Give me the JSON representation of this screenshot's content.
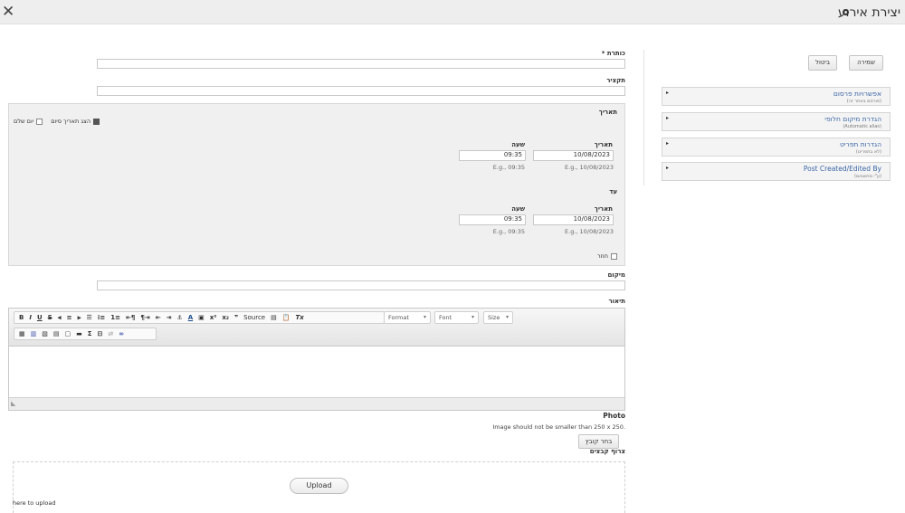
{
  "window": {
    "title": "יצירת אירוע"
  },
  "form": {
    "title_label": "כותרת *",
    "title_value": "",
    "summary_label": "תקציר",
    "summary_value": "",
    "date_section_label": "תאריך",
    "show_end_label": "הצג תאריך סיום",
    "all_day_label": "יום שלם",
    "from": {
      "date_label": "תאריך",
      "time_label": "שעה",
      "date_value": "10/08/2023",
      "time_value": "09:35",
      "date_hint": "E.g., 10/08/2023",
      "time_hint": "E.g., 09:35"
    },
    "until_label": "עד",
    "to": {
      "date_label": "תאריך",
      "time_label": "שעה",
      "date_value": "10/08/2023",
      "time_value": "09:35",
      "date_hint": "E.g., 10/08/2023",
      "time_hint": "E.g., 09:35"
    },
    "repeat_label": "חוזר",
    "location_label": "מיקום",
    "location_value": "",
    "description_label": "תיאור",
    "toolbar": {
      "row1": [
        "B",
        "I",
        "U",
        "S",
        "⫷",
        "≡",
        "⫸",
        "☰",
        "⁝≡",
        "1≡",
        "⇤¶",
        "¶⇥",
        "⇤",
        "⇥",
        "⚓",
        "A",
        "▣",
        "x²",
        "x₂",
        "❞",
        "Source",
        "▤",
        "📋",
        "Tx"
      ],
      "format_label": "Format",
      "font_label": "Font",
      "size_label": "Size",
      "row2": [
        "▦",
        "▥",
        "▧",
        "▤",
        "▢",
        "▬",
        "Σ",
        "⊟",
        "⇄",
        "∞"
      ]
    },
    "photo_label": "Photo",
    "photo_hint": "Image should not be smaller than 250 x 250.",
    "choose_file_label": "בחר קובץ",
    "attachments_label": "צרוף קבצים",
    "upload_label": "Upload",
    "drop_hint": "here to upload"
  },
  "actions": {
    "save_label": "שמירה",
    "cancel_label": "ביטול"
  },
  "sidebar": {
    "panels": [
      {
        "title": "אפשרויות פרסום",
        "subtitle": "(פורסם באתר זה)"
      },
      {
        "title": "הגדרת מיקום חלופי",
        "subtitle": "(Automatic alias)"
      },
      {
        "title": "הגדרות תפריט",
        "subtitle": "(לא בתפריט)"
      },
      {
        "title": "Post Created/Edited By",
        "subtitle": "(ע\"י מחשבשו)"
      }
    ]
  }
}
